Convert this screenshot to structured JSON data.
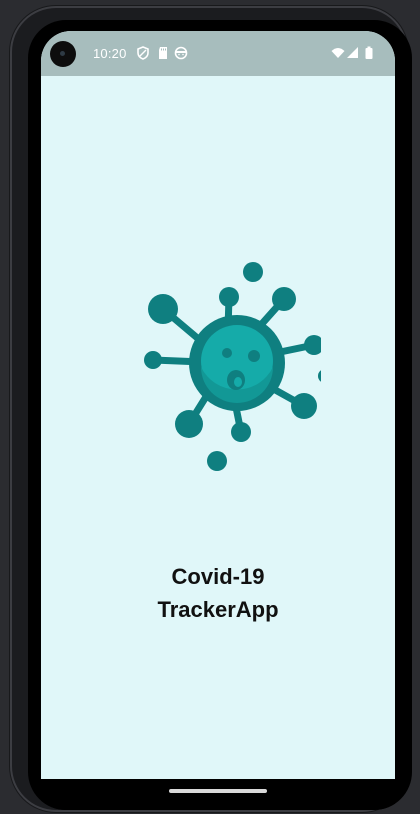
{
  "status_bar": {
    "time": "10:20",
    "left_icons": [
      "shield-icon",
      "sd-card-icon",
      "face-icon"
    ],
    "right_icons": [
      "wifi-icon",
      "signal-icon",
      "battery-icon"
    ]
  },
  "splash": {
    "logo_icon": "virus-icon",
    "title_line1": "Covid-19",
    "title_line2": "TrackerApp"
  },
  "colors": {
    "screen_background": "#e0f7f9",
    "status_bar": "#a7bdbd",
    "virus_dark": "#0f7f80",
    "virus_light": "#15aba9",
    "title_text": "#111111"
  }
}
